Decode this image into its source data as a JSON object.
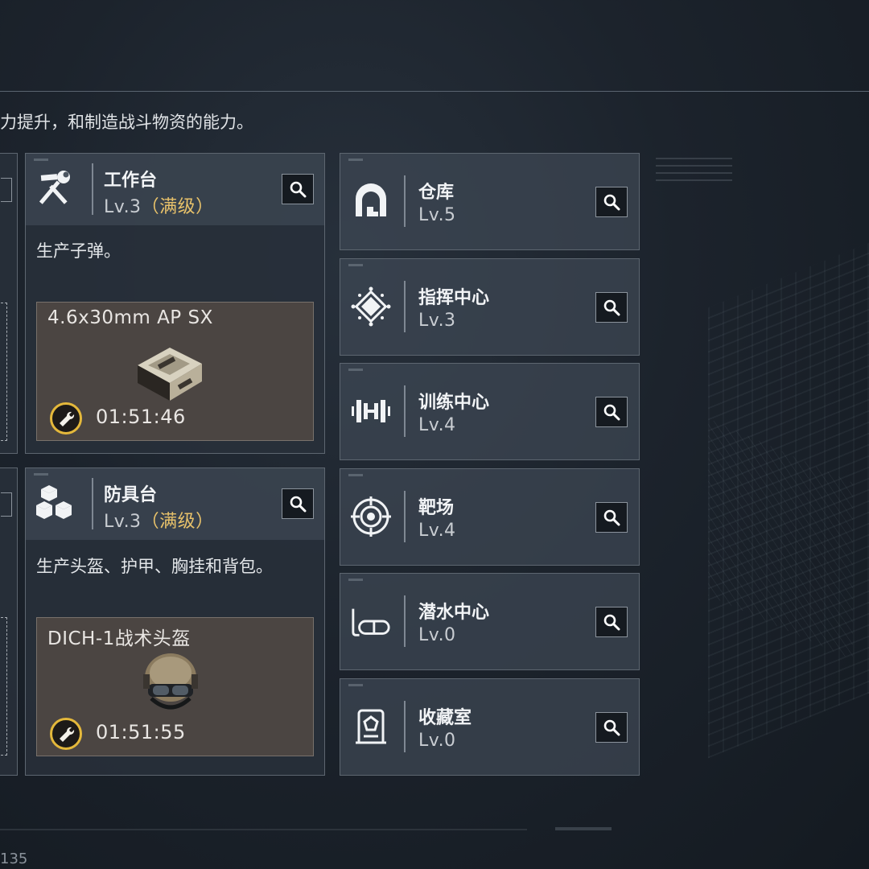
{
  "header": {
    "description": "力提升，和制造战斗物资的能力。"
  },
  "workbench": {
    "title": "工作台",
    "level": "Lv.3",
    "max_tag": "（满级）",
    "description": "生产子弹。",
    "item_name": "4.6x30mm AP SX",
    "timer": "01:51:46"
  },
  "armor_bench": {
    "title": "防具台",
    "level": "Lv.3",
    "max_tag": "（满级）",
    "description": "生产头盔、护甲、胸挂和背包。",
    "item_name": "DICH-1战术头盔",
    "timer": "01:51:55"
  },
  "facilities": [
    {
      "title": "仓库",
      "level": "Lv.5",
      "icon": "warehouse-icon"
    },
    {
      "title": "指挥中心",
      "level": "Lv.3",
      "icon": "command-center-icon"
    },
    {
      "title": "训练中心",
      "level": "Lv.4",
      "icon": "dumbbell-icon"
    },
    {
      "title": "靶场",
      "level": "Lv.4",
      "icon": "target-icon"
    },
    {
      "title": "潜水中心",
      "level": "Lv.0",
      "icon": "diving-mask-icon"
    },
    {
      "title": "收藏室",
      "level": "Lv.0",
      "icon": "collection-icon"
    }
  ],
  "footer": {
    "number": "135"
  },
  "colors": {
    "max_level": "#e7c16a",
    "timer_ring": "#e4b83b",
    "craft_bg": "#4b4542"
  }
}
